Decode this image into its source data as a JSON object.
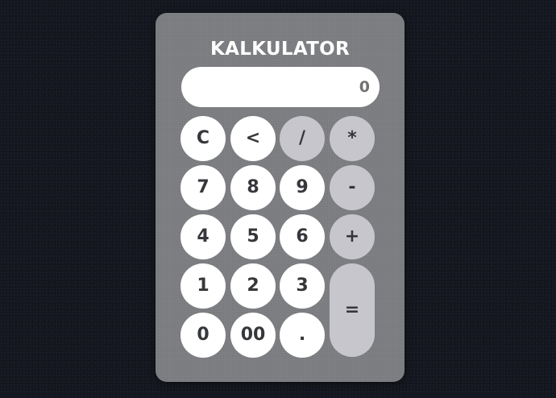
{
  "title": "KALKULATOR",
  "display": {
    "value": "0"
  },
  "colors": {
    "background": "#14171f",
    "panel": "#7a7b7e",
    "key": "#ffffff",
    "operator_key": "#c7c6cc",
    "key_text": "#36373b"
  },
  "keys": {
    "clear": "C",
    "backspace": "<",
    "divide": "/",
    "multiply": "*",
    "seven": "7",
    "eight": "8",
    "nine": "9",
    "subtract": "-",
    "four": "4",
    "five": "5",
    "six": "6",
    "add": "+",
    "one": "1",
    "two": "2",
    "three": "3",
    "equals": "=",
    "zero": "0",
    "double_zero": "00",
    "decimal": "."
  }
}
